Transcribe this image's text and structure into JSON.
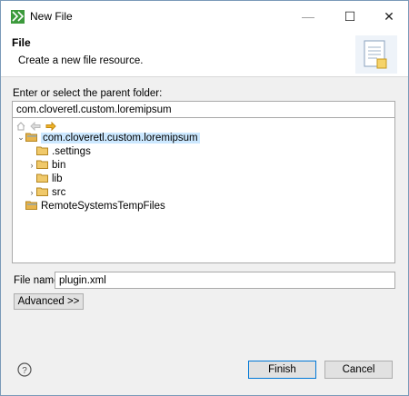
{
  "window": {
    "title": "New File"
  },
  "titlebar": {
    "minimize": "—",
    "maximize": "☐",
    "close": "✕"
  },
  "banner": {
    "title": "File",
    "description": "Create a new file resource."
  },
  "parent": {
    "label": "Enter or select the parent folder:",
    "value": "com.cloveretl.custom.loremipsum"
  },
  "tree": {
    "items": [
      {
        "label": "com.cloveretl.custom.loremipsum",
        "expanded": true,
        "selected": true,
        "type": "project"
      },
      {
        "label": ".settings",
        "expanded": false,
        "has_children": false,
        "type": "folder"
      },
      {
        "label": "bin",
        "expanded": false,
        "has_children": true,
        "type": "folder"
      },
      {
        "label": "lib",
        "expanded": false,
        "has_children": false,
        "type": "folder"
      },
      {
        "label": "src",
        "expanded": false,
        "has_children": true,
        "type": "folder"
      },
      {
        "label": "RemoteSystemsTempFiles",
        "expanded": false,
        "has_children": false,
        "type": "project"
      }
    ]
  },
  "filename": {
    "label": "File name:",
    "value": "plugin.xml"
  },
  "buttons": {
    "advanced": "Advanced >>",
    "finish": "Finish",
    "cancel": "Cancel"
  },
  "colors": {
    "selection": "#cce8ff",
    "folder": "#e8b44c",
    "accent": "#0078d7"
  }
}
